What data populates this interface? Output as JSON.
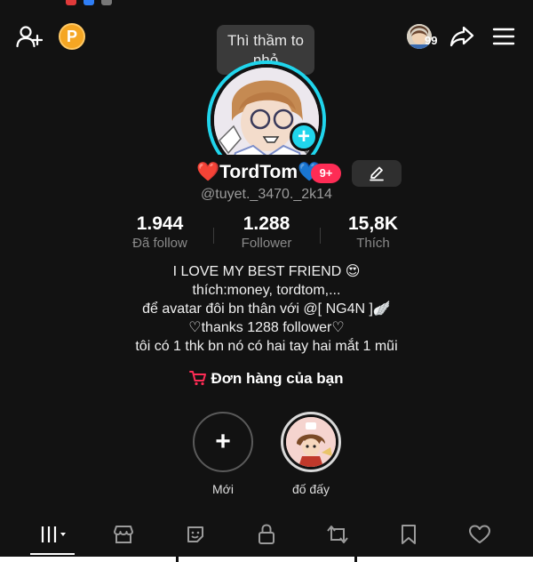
{
  "tooltip": {
    "text": "Thì thầm to nhỏ"
  },
  "coin": {
    "label": "P"
  },
  "profile_counter": {
    "value": "99"
  },
  "profile": {
    "display_name": "❤️TordTom💙",
    "notification_badge": "9+",
    "username": "@tuyet._3470._2k14"
  },
  "stats": [
    {
      "value": "1.944",
      "label": "Đã follow"
    },
    {
      "value": "1.288",
      "label": "Follower"
    },
    {
      "value": "15,8K",
      "label": "Thích"
    }
  ],
  "bio": [
    "I LOVE MY BEST FRIEND 😍",
    "thích:money, tordtom,...",
    "để avatar đôi bn thân với @[ NG4N ]🪽",
    "♡thanks 1288 follower♡",
    "tôi có 1 thk bn nó có hai tay hai mắt 1 mũi"
  ],
  "orders": {
    "label": "Đơn hàng của bạn"
  },
  "highlights": [
    {
      "label": "Mới",
      "icon": "plus-icon"
    },
    {
      "label": "đố đấy",
      "icon": "character-thumbnail"
    }
  ],
  "tabs": [
    {
      "name": "videos",
      "icon": "grid-icon",
      "selected": true
    },
    {
      "name": "shop",
      "icon": "store-icon"
    },
    {
      "name": "stickers",
      "icon": "sticker-icon"
    },
    {
      "name": "private",
      "icon": "lock-icon"
    },
    {
      "name": "reposts",
      "icon": "repost-icon"
    },
    {
      "name": "saved",
      "icon": "bookmark-icon"
    },
    {
      "name": "liked",
      "icon": "heart-icon"
    }
  ],
  "colors": {
    "background": "#121212",
    "accent_cyan": "#20d5ec",
    "accent_red": "#fe2c55",
    "coin": "#f5a623"
  }
}
